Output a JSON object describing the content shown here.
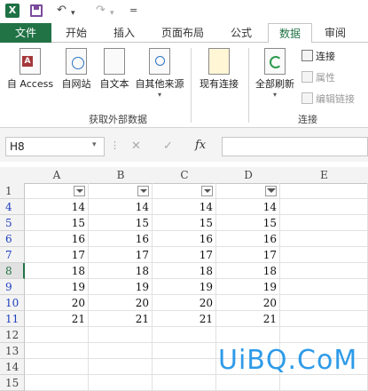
{
  "quick_access": {
    "app_icon": "X",
    "undo": "↶",
    "redo": "↷",
    "more": "="
  },
  "tabs": [
    "文件",
    "开始",
    "插入",
    "页面布局",
    "公式",
    "数据",
    "审阅"
  ],
  "ribbon": {
    "buttons": [
      "自 Access",
      "自网站",
      "自文本",
      "自其他来源",
      "现有连接",
      "全部刷新"
    ],
    "group_external": "获取外部数据",
    "group_connections": "连接",
    "connections_items": [
      "连接",
      "属性",
      "编辑链接"
    ]
  },
  "formula_bar": {
    "name_box": "H8",
    "cancel": "✕",
    "enter": "✓",
    "fx": "fx"
  },
  "columns": [
    "A",
    "B",
    "C",
    "D",
    "E"
  ],
  "rows": [
    {
      "n": "1",
      "vals": [
        "",
        "",
        "",
        ""
      ]
    },
    {
      "n": "4",
      "vals": [
        "14",
        "14",
        "14",
        "14"
      ]
    },
    {
      "n": "5",
      "vals": [
        "15",
        "15",
        "15",
        "15"
      ]
    },
    {
      "n": "6",
      "vals": [
        "16",
        "16",
        "16",
        "16"
      ]
    },
    {
      "n": "7",
      "vals": [
        "17",
        "17",
        "17",
        "17"
      ]
    },
    {
      "n": "8",
      "vals": [
        "18",
        "18",
        "18",
        "18"
      ]
    },
    {
      "n": "9",
      "vals": [
        "19",
        "19",
        "19",
        "19"
      ]
    },
    {
      "n": "10",
      "vals": [
        "20",
        "20",
        "20",
        "20"
      ]
    },
    {
      "n": "11",
      "vals": [
        "21",
        "21",
        "21",
        "21"
      ]
    },
    {
      "n": "12",
      "vals": [
        "",
        "",
        "",
        ""
      ]
    },
    {
      "n": "13",
      "vals": [
        "",
        "",
        "",
        ""
      ]
    },
    {
      "n": "14",
      "vals": [
        "",
        "",
        "",
        ""
      ]
    },
    {
      "n": "15",
      "vals": [
        "",
        "",
        "",
        ""
      ]
    }
  ],
  "selected_row": "8",
  "blue_rows": [
    "4",
    "5",
    "6",
    "7",
    "8",
    "9",
    "10",
    "11"
  ],
  "watermark": "UiBQ.CoM",
  "colors": {
    "excel_green": "#217346",
    "row_blue": "#1f3fbf",
    "watermark": "#2e9be8"
  }
}
